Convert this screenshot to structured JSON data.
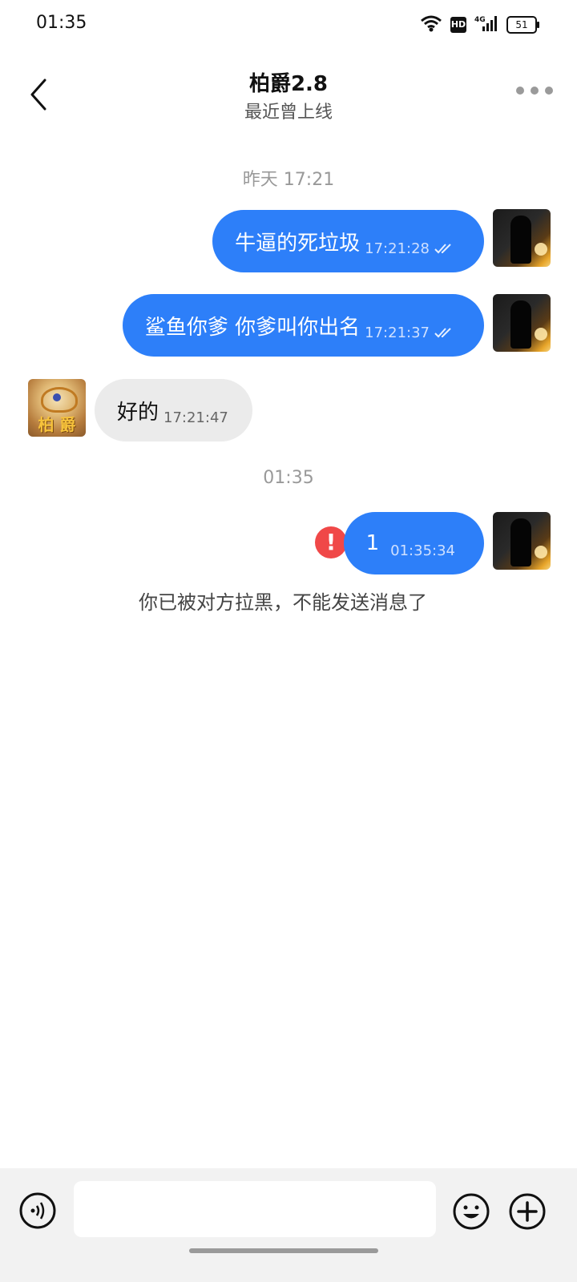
{
  "status_bar": {
    "time": "01:35",
    "network": "4G",
    "hd": "HD",
    "battery": "51"
  },
  "header": {
    "title": "柏爵2.8",
    "subtitle": "最近曾上线"
  },
  "timestamps": [
    "昨天 17:21",
    "01:35"
  ],
  "messages": [
    {
      "direction": "out",
      "text": "牛逼的死垃圾",
      "time": "17:21:28",
      "status": "read"
    },
    {
      "direction": "out",
      "text": "鲨鱼你爹 你爹叫你出名",
      "time": "17:21:37",
      "status": "read"
    },
    {
      "direction": "in",
      "text": "好的",
      "time": "17:21:47"
    },
    {
      "direction": "out",
      "text": "1",
      "time": "01:35:34",
      "status": "failed"
    }
  ],
  "friend_avatar_text": "柏 爵",
  "notice": "你已被对方拉黑，不能发送消息了",
  "input": {
    "value": "",
    "placeholder": ""
  },
  "colors": {
    "outgoing_bubble": "#2d7ff9",
    "incoming_bubble": "#ebebeb",
    "error": "#f04848"
  },
  "icons": [
    "back-arrow-icon",
    "more-dots-icon",
    "voice-icon",
    "emoji-icon",
    "plus-icon",
    "error-icon",
    "double-check-icon"
  ]
}
